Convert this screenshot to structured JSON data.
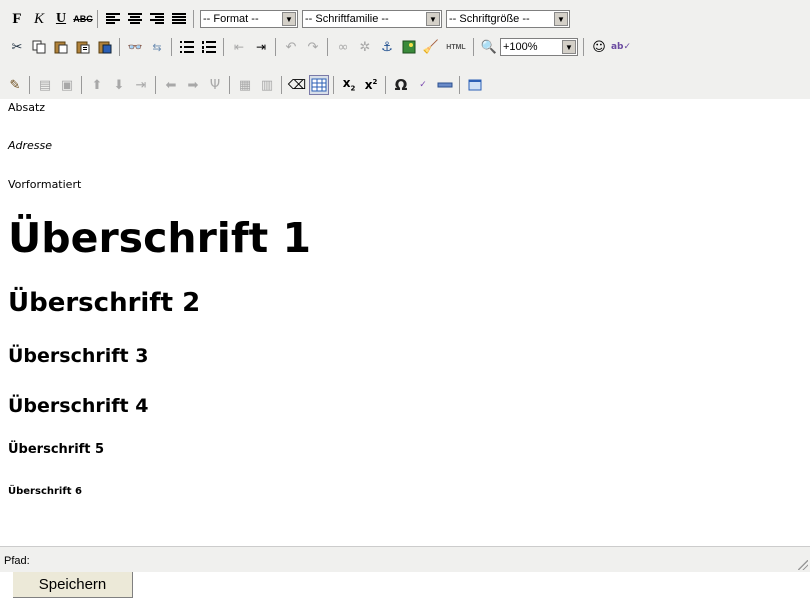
{
  "toolbar": {
    "bold_label": "F",
    "italic_label": "K",
    "underline_label": "U",
    "strike_label": "ABC",
    "format_select": "-- Format --",
    "fontfamily_select": "-- Schriftfamilie --",
    "fontsize_select": "-- Schriftgröße --",
    "zoom_select": "+100%",
    "html_label": "HTML"
  },
  "content": {
    "paragraph": "Absatz",
    "address": "Adresse",
    "preformatted": "Vorformatiert",
    "heading1": "Überschrift 1",
    "heading2": "Überschrift 2",
    "heading3": "Überschrift 3",
    "heading4": "Überschrift 4",
    "heading5": "Überschrift 5",
    "heading6": "Überschrift 6"
  },
  "statusbar": {
    "path_label": "Pfad:"
  },
  "save_button": "Speichern"
}
